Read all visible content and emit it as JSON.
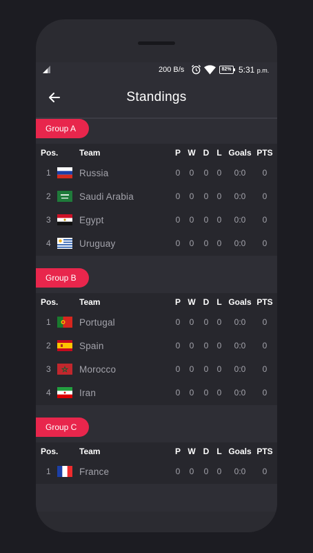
{
  "status_bar": {
    "net_speed": "200 B/s",
    "battery": "82%",
    "time": "5:31",
    "ampm": "p.m."
  },
  "app_bar": {
    "title": "Standings",
    "back_icon": "arrow-left-icon"
  },
  "table_headers": {
    "pos": "Pos.",
    "team": "Team",
    "p": "P",
    "w": "W",
    "d": "D",
    "l": "L",
    "goals": "Goals",
    "pts": "PTS"
  },
  "colors": {
    "accent": "#e8264c",
    "background": "#2e2e35",
    "card": "#27272d"
  },
  "groups": [
    {
      "name": "Group A",
      "teams": [
        {
          "pos": "1",
          "name": "Russia",
          "flag": "russia-flag",
          "p": "0",
          "w": "0",
          "d": "0",
          "l": "0",
          "goals": "0:0",
          "pts": "0"
        },
        {
          "pos": "2",
          "name": "Saudi Arabia",
          "flag": "saudi-arabia-flag",
          "p": "0",
          "w": "0",
          "d": "0",
          "l": "0",
          "goals": "0:0",
          "pts": "0"
        },
        {
          "pos": "3",
          "name": "Egypt",
          "flag": "egypt-flag",
          "p": "0",
          "w": "0",
          "d": "0",
          "l": "0",
          "goals": "0:0",
          "pts": "0"
        },
        {
          "pos": "4",
          "name": "Uruguay",
          "flag": "uruguay-flag",
          "p": "0",
          "w": "0",
          "d": "0",
          "l": "0",
          "goals": "0:0",
          "pts": "0"
        }
      ]
    },
    {
      "name": "Group B",
      "teams": [
        {
          "pos": "1",
          "name": "Portugal",
          "flag": "portugal-flag",
          "p": "0",
          "w": "0",
          "d": "0",
          "l": "0",
          "goals": "0:0",
          "pts": "0"
        },
        {
          "pos": "2",
          "name": "Spain",
          "flag": "spain-flag",
          "p": "0",
          "w": "0",
          "d": "0",
          "l": "0",
          "goals": "0:0",
          "pts": "0"
        },
        {
          "pos": "3",
          "name": "Morocco",
          "flag": "morocco-flag",
          "p": "0",
          "w": "0",
          "d": "0",
          "l": "0",
          "goals": "0:0",
          "pts": "0"
        },
        {
          "pos": "4",
          "name": "Iran",
          "flag": "iran-flag",
          "p": "0",
          "w": "0",
          "d": "0",
          "l": "0",
          "goals": "0:0",
          "pts": "0"
        }
      ]
    },
    {
      "name": "Group C",
      "teams": [
        {
          "pos": "1",
          "name": "France",
          "flag": "france-flag",
          "p": "0",
          "w": "0",
          "d": "0",
          "l": "0",
          "goals": "0:0",
          "pts": "0"
        }
      ]
    }
  ]
}
